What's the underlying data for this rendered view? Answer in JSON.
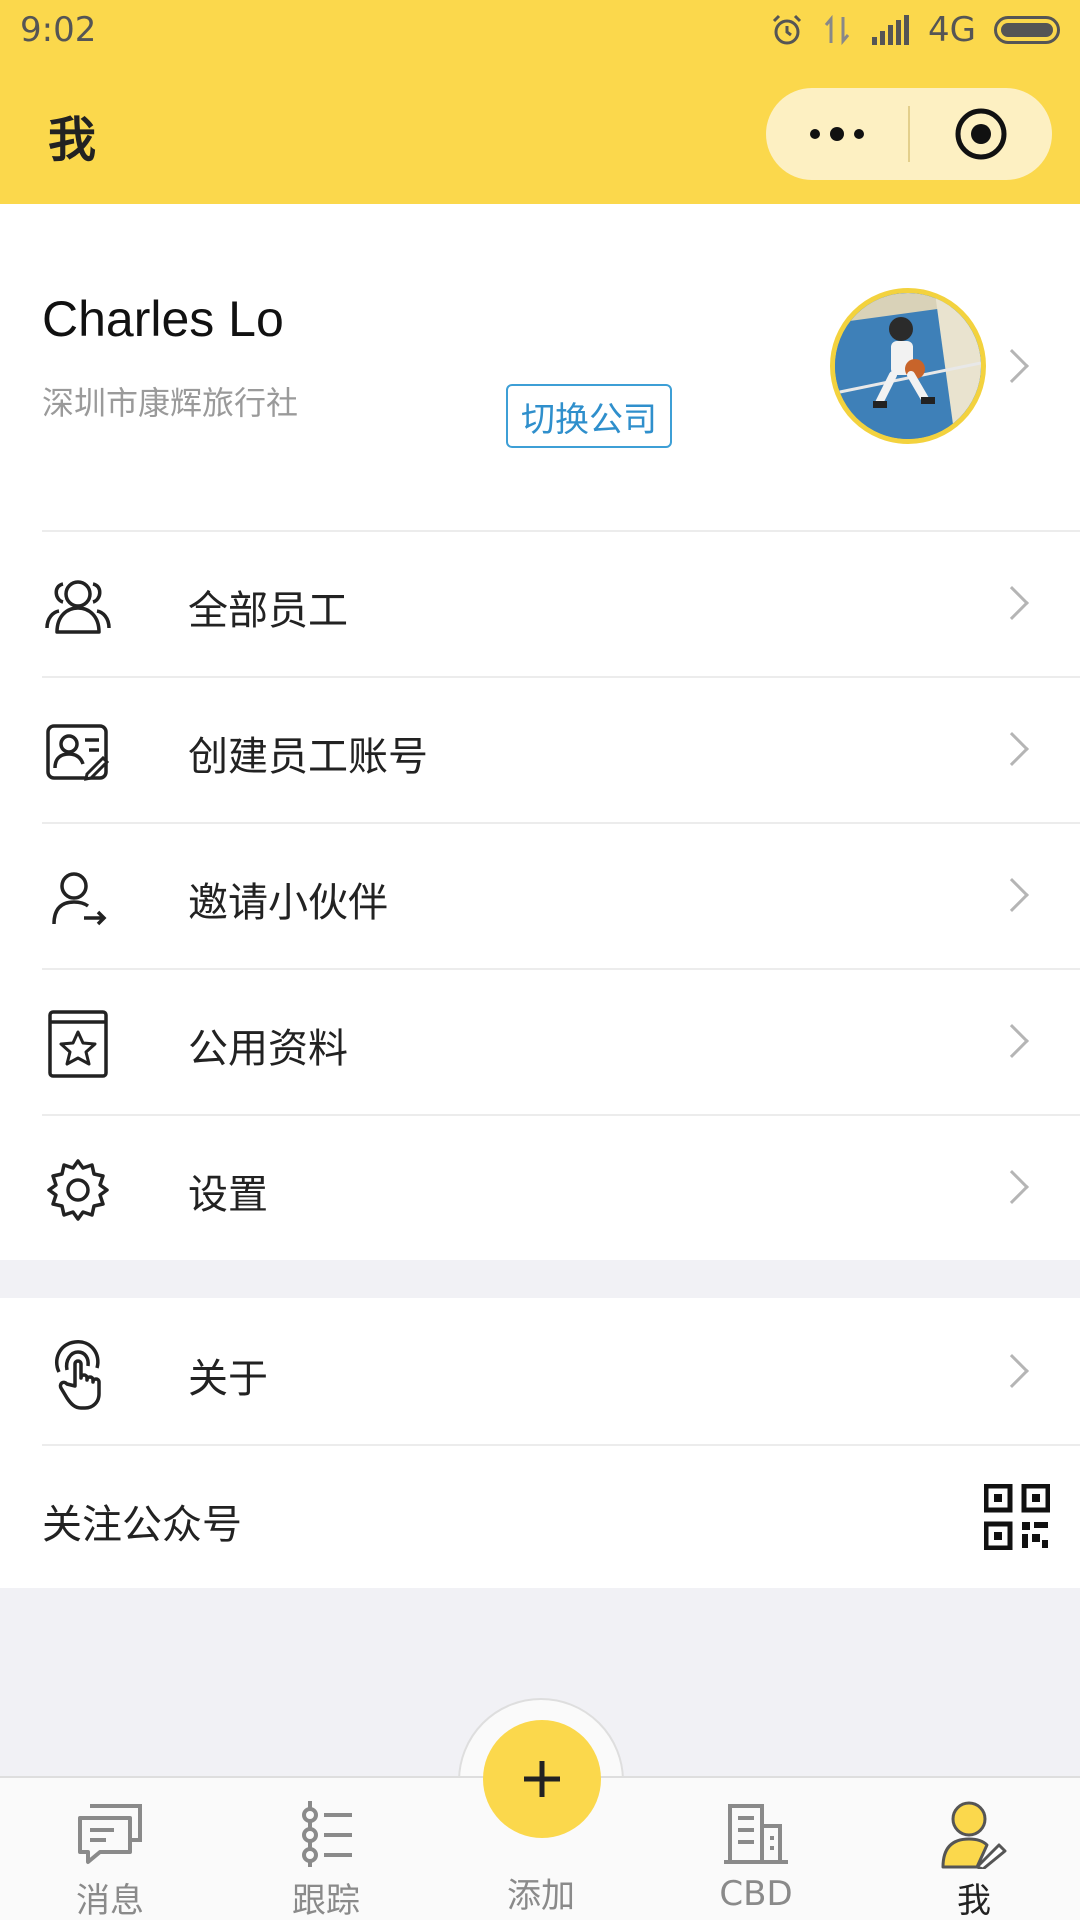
{
  "status_bar": {
    "time": "9:02",
    "network": "4G"
  },
  "header": {
    "title": "我"
  },
  "profile": {
    "name": "Charles Lo",
    "company": "深圳市康辉旅行社",
    "switch_company_label": "切换公司"
  },
  "menu": {
    "items": [
      {
        "label": "全部员工",
        "icon": "group-icon"
      },
      {
        "label": "创建员工账号",
        "icon": "id-card-edit-icon"
      },
      {
        "label": "邀请小伙伴",
        "icon": "user-invite-icon"
      },
      {
        "label": "公用资料",
        "icon": "star-book-icon"
      },
      {
        "label": "设置",
        "icon": "gear-icon"
      }
    ],
    "about_label": "关于",
    "follow_label": "关注公众号"
  },
  "tabbar": {
    "tabs": [
      {
        "label": "消息",
        "icon": "message-icon"
      },
      {
        "label": "跟踪",
        "icon": "list-icon"
      },
      {
        "label": "添加",
        "icon": "plus-icon"
      },
      {
        "label": "CBD",
        "icon": "building-icon"
      },
      {
        "label": "我",
        "icon": "user-edit-icon"
      }
    ]
  },
  "colors": {
    "brand_yellow": "#fbd84c",
    "link_blue": "#2f8fcc"
  }
}
